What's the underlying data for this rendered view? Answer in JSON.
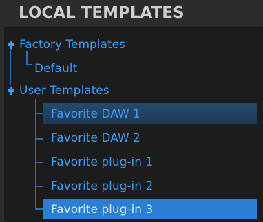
{
  "panel": {
    "title": "LOCAL TEMPLATES"
  },
  "tree": {
    "groups": [
      {
        "label": "Factory Templates",
        "expanded": true,
        "children": [
          {
            "label": "Default"
          }
        ]
      },
      {
        "label": "User Templates",
        "expanded": true,
        "children": [
          {
            "label": "Favorite DAW 1",
            "state": "highlighted"
          },
          {
            "label": "Favorite DAW 2"
          },
          {
            "label": "Favorite plug-in 1"
          },
          {
            "label": "Favorite plug-in 2"
          },
          {
            "label": "Favorite plug-in 3",
            "state": "selected"
          }
        ]
      }
    ]
  },
  "colors": {
    "background": "#2c2c2c",
    "tree_background": "#1c1c1c",
    "item_text": "#3d9bf5",
    "tree_lines": "#2e6fb4",
    "selection": "#2a7fd3",
    "highlight": "#264a6c",
    "title_text": "#cfcfcf"
  }
}
